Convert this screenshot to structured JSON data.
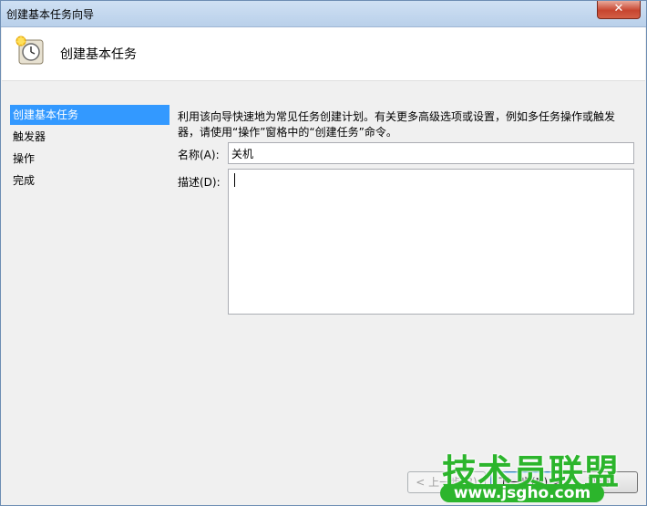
{
  "window": {
    "title": "创建基本任务向导",
    "close_label": "✕"
  },
  "header": {
    "title": "创建基本任务"
  },
  "nav": {
    "items": [
      {
        "label": "创建基本任务"
      },
      {
        "label": "触发器"
      },
      {
        "label": "操作"
      },
      {
        "label": "完成"
      }
    ]
  },
  "form": {
    "intro_line1": "利用该向导快速地为常见任务创建计划。有关更多高级选项或设置，例如多任务操作或触发",
    "intro_line2": "器，请使用“操作”窗格中的“创建任务”命令。",
    "name_label": "名称(A):",
    "name_value": "关机",
    "desc_label": "描述(D):",
    "desc_value": ""
  },
  "buttons": {
    "back_label": "< 上一步(B)",
    "next_label": "下一步(N) >",
    "cancel_label": "取消"
  },
  "watermark": {
    "text": "技术员联盟",
    "url": "www.jsgho.com"
  }
}
